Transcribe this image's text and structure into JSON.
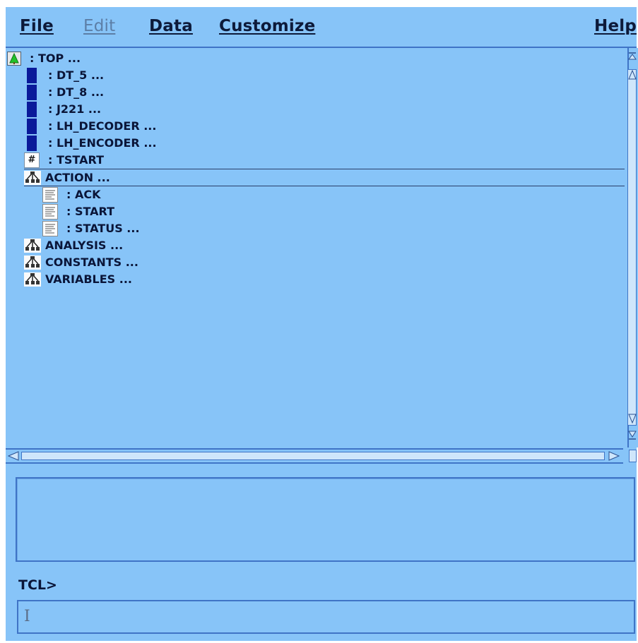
{
  "menubar": {
    "file": "File",
    "edit": "Edit",
    "data": "Data",
    "customize": "Customize",
    "help": "Help"
  },
  "tree": {
    "top": ": TOP ...",
    "children": [
      {
        "icon": "block-icon",
        "label": ": DT_5 ..."
      },
      {
        "icon": "block-icon",
        "label": ": DT_8 ..."
      },
      {
        "icon": "block-icon",
        "label": ": J221 ..."
      },
      {
        "icon": "block-icon",
        "label": ": LH_DECODER ..."
      },
      {
        "icon": "block-icon",
        "label": ": LH_ENCODER ..."
      },
      {
        "icon": "hash-icon",
        "label": ": TSTART",
        "glyph": "#"
      }
    ],
    "groups": [
      {
        "label": "ACTION ...",
        "selected": true,
        "items": [
          ": ACK",
          ": START",
          ": STATUS ..."
        ]
      },
      {
        "label": "ANALYSIS ...",
        "selected": false,
        "items": []
      },
      {
        "label": "CONSTANTS ...",
        "selected": false,
        "items": []
      },
      {
        "label": "VARIABLES ...",
        "selected": false,
        "items": []
      }
    ]
  },
  "console": {
    "output": "",
    "prompt_label": "TCL>",
    "input_value": ""
  },
  "colors": {
    "background": "#87c4f8",
    "accent": "#3f74c6",
    "block_icon": "#0a1a9a",
    "top_icon": "#22c22a"
  }
}
